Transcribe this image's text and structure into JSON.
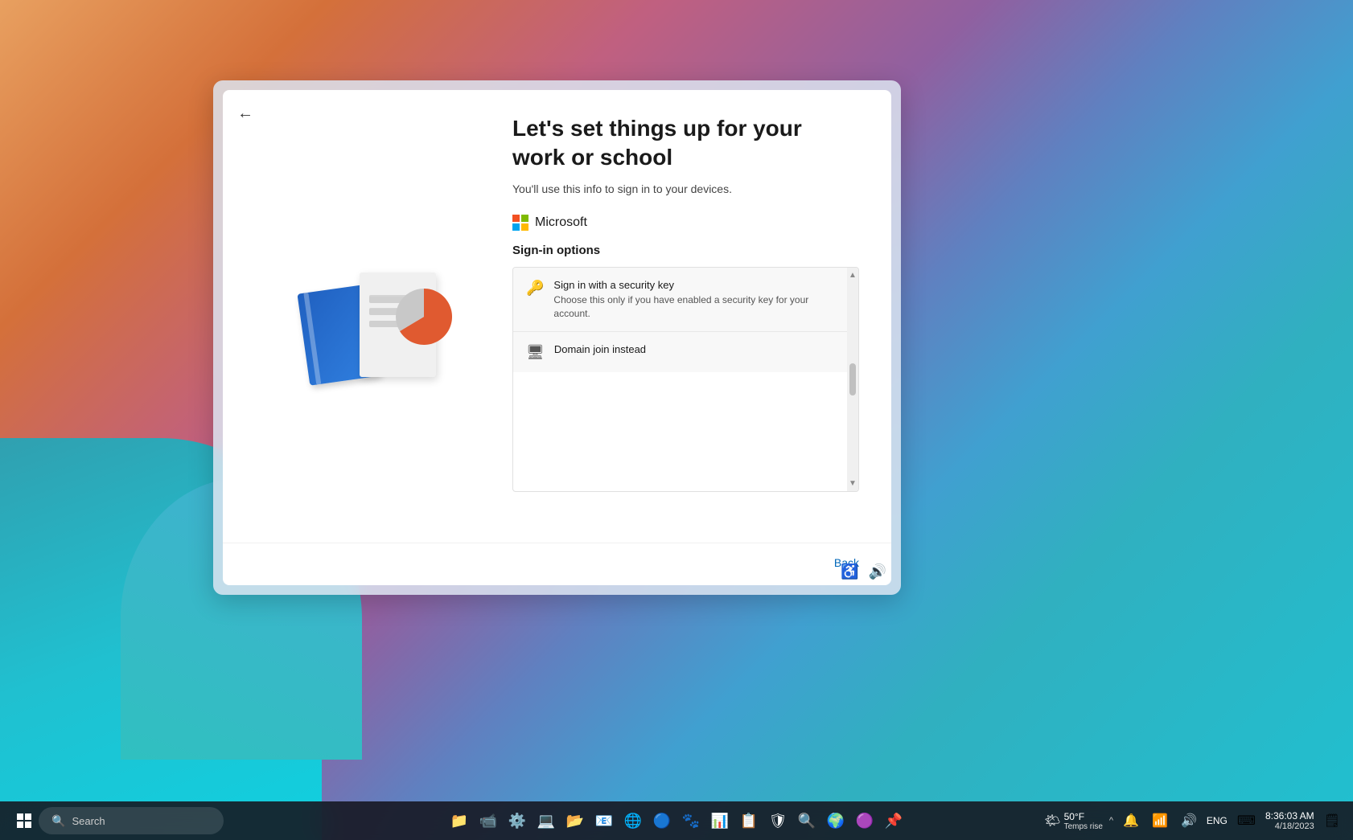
{
  "desktop": {
    "bg": "gradient-purple-orange-teal"
  },
  "setup_window": {
    "title": "Let's set things up for your work or school",
    "subtitle": "You'll use this info to sign in to your devices.",
    "back_arrow_label": "←",
    "microsoft_label": "Microsoft",
    "sign_in_options_heading": "Sign-in options",
    "sign_in_options": [
      {
        "id": "security-key",
        "title": "Sign in with a security key",
        "description": "Choose this only if you have enabled a security key for your account.",
        "icon": "🔑"
      },
      {
        "id": "domain-join",
        "title": "Domain join instead",
        "description": "",
        "icon": "🖥"
      }
    ],
    "back_button_label": "Back"
  },
  "window_icons": {
    "accessibility_icon": "♿",
    "volume_icon": "🔊"
  },
  "taskbar": {
    "search_placeholder": "Search",
    "weather": {
      "temp": "50°F",
      "trend": "Temps rise"
    },
    "system_tray": {
      "chevron_label": "^",
      "language": "ENG",
      "keyboard_icon": "⌨",
      "time": "8:36:03 AM",
      "date": "4/18/2023"
    },
    "app_icons": [
      {
        "name": "file-explorer",
        "glyph": "📁"
      },
      {
        "name": "teams",
        "glyph": "📹"
      },
      {
        "name": "settings",
        "glyph": "⚙"
      },
      {
        "name": "terminal",
        "glyph": "💻"
      },
      {
        "name": "file-manager",
        "glyph": "📂"
      },
      {
        "name": "outlook",
        "glyph": "📧"
      },
      {
        "name": "edge",
        "glyph": "🌐"
      },
      {
        "name": "edge-alt",
        "glyph": "🔵"
      },
      {
        "name": "app8",
        "glyph": "🐾"
      },
      {
        "name": "app9",
        "glyph": "📊"
      },
      {
        "name": "app10",
        "glyph": "📋"
      },
      {
        "name": "app11",
        "glyph": "🛡"
      },
      {
        "name": "app12",
        "glyph": "🔍"
      },
      {
        "name": "chrome",
        "glyph": "🌍"
      },
      {
        "name": "app14",
        "glyph": "🟣"
      },
      {
        "name": "app15",
        "glyph": "📌"
      }
    ]
  }
}
